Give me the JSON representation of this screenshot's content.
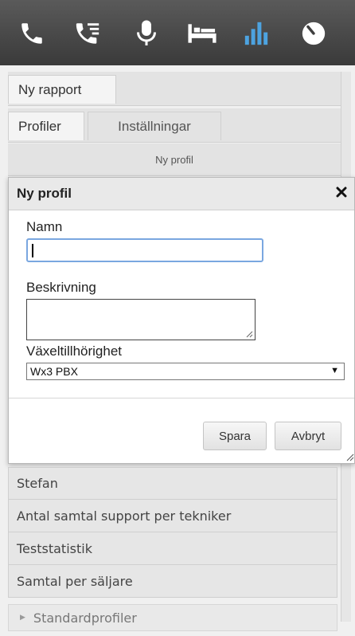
{
  "toolbar": {
    "icons": [
      "phone-icon",
      "call-list-icon",
      "microphone-icon",
      "bed-icon",
      "bar-chart-icon",
      "clock-icon"
    ],
    "active_icon": "bar-chart-icon",
    "active_color": "#4da3e0"
  },
  "tabs": {
    "report_tab": "Ny rapport",
    "profiles_tab": "Profiler",
    "settings_tab": "Inställningar"
  },
  "subbar": {
    "new_profile_link": "Ny profil"
  },
  "dialog": {
    "title": "Ny profil",
    "name_label": "Namn",
    "name_value": "",
    "description_label": "Beskrivning",
    "description_value": "",
    "switch_label": "Växeltillhörighet",
    "switch_selected": "Wx3 PBX",
    "save_button": "Spara",
    "cancel_button": "Avbryt"
  },
  "profiles": {
    "items": [
      "Stefan",
      "Antal samtal support per tekniker",
      "Teststatistik",
      "Samtal per säljare"
    ],
    "standard_group": "Standardprofiler"
  }
}
